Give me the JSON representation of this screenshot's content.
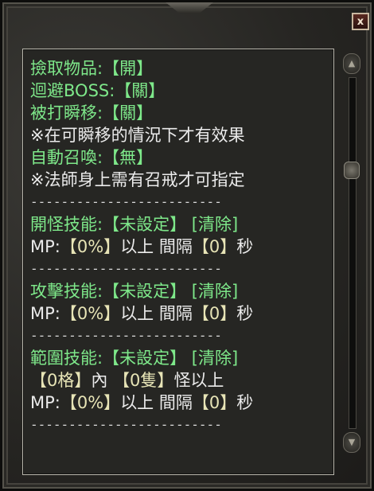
{
  "window": {
    "close_label": "x"
  },
  "settings": {
    "pickup": {
      "label": "撿取物品:",
      "value": "【開】"
    },
    "avoid_boss": {
      "label": "迴避BOSS:",
      "value": "【關】"
    },
    "hit_teleport": {
      "label": "被打瞬移:",
      "value": "【關】"
    },
    "teleport_note": "※在可瞬移的情況下才有效果",
    "auto_summon": {
      "label": "自動召喚:",
      "value": "【無】"
    },
    "summon_note": "※法師身上需有召戒才可指定"
  },
  "divider": "-------------------------",
  "opening_skill": {
    "label": "開怪技能:",
    "value": "【未設定】",
    "clear": "[清除]",
    "mp_prefix": "MP:",
    "mp_value": "【0%】",
    "mp_mid": "以上 間隔",
    "interval_value": "【0】",
    "unit": "秒"
  },
  "attack_skill": {
    "label": "攻擊技能:",
    "value": "【未設定】",
    "clear": "[清除]",
    "mp_prefix": "MP:",
    "mp_value": "【0%】",
    "mp_mid": "以上 間隔",
    "interval_value": "【0】",
    "unit": "秒"
  },
  "area_skill": {
    "label": "範圍技能:",
    "value": "【未設定】",
    "clear": "[清除]",
    "range_value": "【0格】",
    "range_mid": "內",
    "count_value": "【0隻】",
    "count_suffix": "怪以上",
    "mp_prefix": "MP:",
    "mp_value": "【0%】",
    "mp_mid": "以上 間隔",
    "interval_value": "【0】",
    "unit": "秒"
  }
}
